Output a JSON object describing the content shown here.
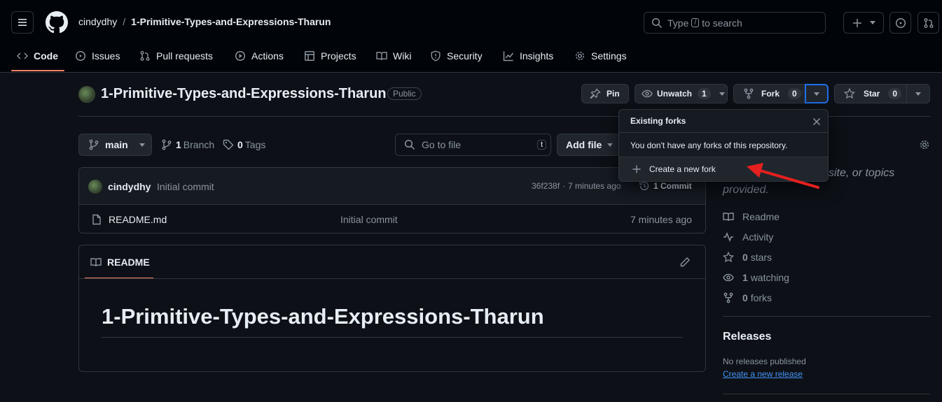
{
  "header": {
    "owner": "cindydhy",
    "separator": "/",
    "repo": "1-Primitive-Types-and-Expressions-Tharun",
    "search_prefix": "Type",
    "search_key": "/",
    "search_suffix": "to search"
  },
  "tabs": [
    {
      "label": "Code"
    },
    {
      "label": "Issues"
    },
    {
      "label": "Pull requests"
    },
    {
      "label": "Actions"
    },
    {
      "label": "Projects"
    },
    {
      "label": "Wiki"
    },
    {
      "label": "Security"
    },
    {
      "label": "Insights"
    },
    {
      "label": "Settings"
    }
  ],
  "repo": {
    "name": "1-Primitive-Types-and-Expressions-Tharun",
    "visibility": "Public",
    "pin": "Pin",
    "unwatch": "Unwatch",
    "watch_count": "1",
    "fork": "Fork",
    "fork_count": "0",
    "star": "Star",
    "star_count": "0"
  },
  "toolbar": {
    "branch": "main",
    "branches_count": "1",
    "branches_label": "Branch",
    "tags_count": "0",
    "tags_label": "Tags",
    "go_to_file": "Go to file",
    "go_to_file_key": "t",
    "add_file": "Add file"
  },
  "commit": {
    "author": "cindydhy",
    "message": "Initial commit",
    "hash": "36f238f",
    "dot": "·",
    "time": "7 minutes ago",
    "count_label": "1 Commit"
  },
  "files": [
    {
      "name": "README.md",
      "message": "Initial commit",
      "time": "7 minutes ago"
    }
  ],
  "readme": {
    "tab": "README",
    "heading": "1-Primitive-Types-and-Expressions-Tharun"
  },
  "fork_dropdown": {
    "title": "Existing forks",
    "empty": "You don't have any forks of this repository.",
    "create": "Create a new fork"
  },
  "sidebar": {
    "about_line1": "site, or topics",
    "about_line2": "provided.",
    "readme": "Readme",
    "activity": "Activity",
    "stars_count": "0",
    "stars_label": "stars",
    "watching_count": "1",
    "watching_label": "watching",
    "forks_count": "0",
    "forks_label": "forks",
    "releases_title": "Releases",
    "no_releases": "No releases published",
    "create_release": "Create a new release"
  },
  "colors": {
    "accent_underline": "#f78166",
    "annotation_arrow": "#e5201e",
    "link": "#4493f8"
  }
}
